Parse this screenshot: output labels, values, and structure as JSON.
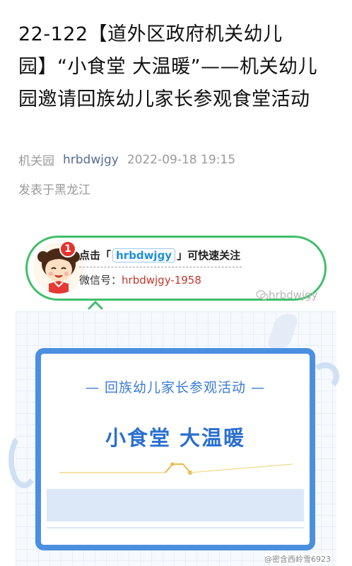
{
  "article": {
    "title": "22-122【道外区政府机关幼儿园】“小食堂 大温暖”——机关幼儿园邀请回族幼儿家长参观食堂活动",
    "author": "机关园",
    "account": "hrbdwjgy",
    "datetime": "2022-09-18 19:15",
    "location": "发表于黑龙江"
  },
  "follow_banner": {
    "badge_count": "1",
    "prefix": "点击「",
    "account": "hrbdwjgy",
    "suffix": "」可快速关注",
    "wechat_label": "微信号：",
    "wechat_id": "hrbdwjgy-1958",
    "watermark": "hrbdwjgy"
  },
  "poster": {
    "subtitle": "— 回族幼儿家长参观活动 —",
    "headline": "小食堂  大温暖"
  },
  "footer_watermark": "@密含西岭雪6923",
  "colors": {
    "accent_green": "#3fbf6a",
    "poster_blue": "#4a8fe0",
    "link_blue": "#576b95",
    "wechat_id_red": "#c0392b"
  }
}
